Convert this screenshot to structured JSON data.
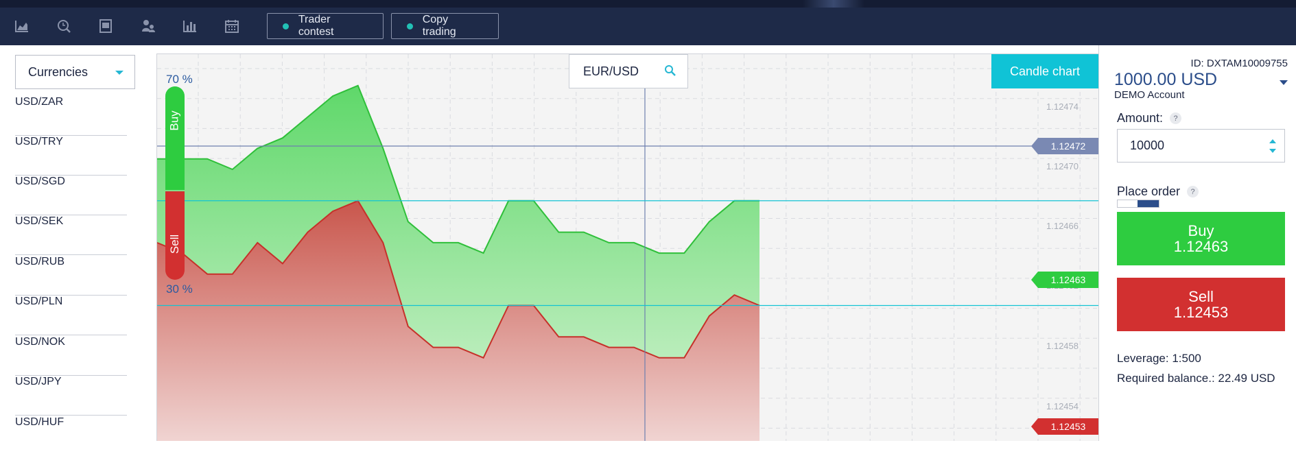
{
  "toolbar": {
    "icons": [
      "area-chart-icon",
      "search-history-icon",
      "book-icon",
      "users-icon",
      "bar-chart-icon",
      "calendar-icon"
    ],
    "buttons": [
      {
        "label": "Trader contest"
      },
      {
        "label": "Copy trading"
      }
    ],
    "dot_color": "#22c0b5"
  },
  "sidebar": {
    "select_label": "Currencies",
    "items": [
      "USD/ZAR",
      "USD/TRY",
      "USD/SGD",
      "USD/SEK",
      "USD/RUB",
      "USD/PLN",
      "USD/NOK",
      "USD/JPY",
      "USD/HUF"
    ]
  },
  "chart": {
    "symbol": "EUR/USD",
    "mode_button": "Candle chart",
    "buy_pct": "70 %",
    "sell_pct": "30 %",
    "buy_label": "Buy",
    "sell_label": "Sell",
    "ticks": [
      "1.12474",
      "1.12470",
      "1.12466",
      "1.12462",
      "1.12458",
      "1.12454"
    ],
    "crosshair_price": "1.12472",
    "ask_price": "1.12463",
    "bid_price": "1.12453",
    "colors": {
      "buy": "#2ecc40",
      "sell": "#d23030",
      "crosshair_tag": "#7a89b3",
      "level_line": "#13c3d3"
    }
  },
  "chart_data": {
    "type": "area",
    "series": [
      {
        "name": "Buy",
        "values": [
          1.12467,
          1.12467,
          1.12467,
          1.12466,
          1.12468,
          1.12469,
          1.12471,
          1.12473,
          1.12474,
          1.12468,
          1.12461,
          1.12459,
          1.12459,
          1.12458,
          1.12463,
          1.12463,
          1.1246,
          1.1246,
          1.12459,
          1.12459,
          1.12458,
          1.12458,
          1.12461,
          1.12463,
          1.12463
        ]
      },
      {
        "name": "Sell",
        "values": [
          1.12459,
          1.12458,
          1.12456,
          1.12456,
          1.12459,
          1.12457,
          1.1246,
          1.12462,
          1.12463,
          1.12459,
          1.12451,
          1.12449,
          1.12449,
          1.12448,
          1.12453,
          1.12453,
          1.1245,
          1.1245,
          1.12449,
          1.12449,
          1.12448,
          1.12448,
          1.12452,
          1.12454,
          1.12453
        ]
      }
    ],
    "ylim": [
      1.1244,
      1.12477
    ],
    "grid": true
  },
  "panel": {
    "account_id": "ID: DXTAM10009755",
    "balance": "1000.00 USD",
    "account_type": "DEMO Account",
    "amount_label": "Amount:",
    "amount_value": "10000",
    "place_order_label": "Place order",
    "help": "?",
    "buy_label": "Buy",
    "buy_price": "1.12463",
    "sell_label": "Sell",
    "sell_price": "1.12453",
    "leverage": "Leverage: 1:500",
    "required_balance": "Required balance.: 22.49 USD"
  }
}
